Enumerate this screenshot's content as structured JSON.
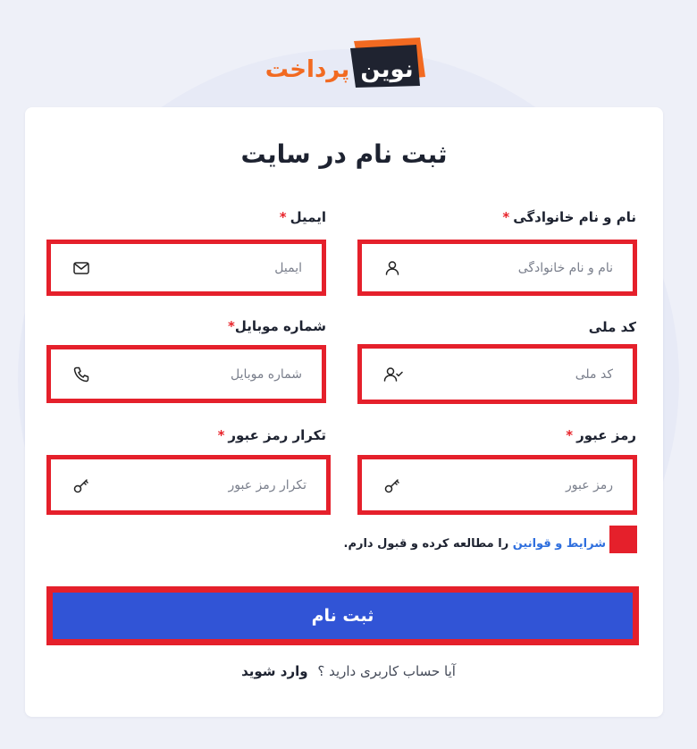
{
  "brand": {
    "logo_text": "نوین پرداخت",
    "accent": "#f26a21",
    "dark": "#1f2330"
  },
  "form": {
    "title": "ثبت نام در سایت",
    "required_mark": "*",
    "fields": {
      "full_name": {
        "label": "نام و نام خانوادگی",
        "placeholder": "نام و نام خانوادگی",
        "value": "",
        "required": true,
        "icon": "user-icon"
      },
      "email": {
        "label": "ایمیل",
        "placeholder": "ایمیل",
        "value": "",
        "required": true,
        "icon": "mail-icon"
      },
      "national_code": {
        "label": "کد ملی",
        "placeholder": "کد ملی",
        "value": "",
        "required": false,
        "icon": "user-check-icon"
      },
      "mobile": {
        "label": "شماره موبایل",
        "placeholder": "شماره موبایل",
        "value": "",
        "required": true,
        "icon": "phone-icon"
      },
      "password": {
        "label": "رمز عبور",
        "placeholder": "رمز عبور",
        "value": "",
        "required": true,
        "icon": "key-icon"
      },
      "password_confirm": {
        "label": "تکرار رمز عبور",
        "placeholder": "تکرار رمز عبور",
        "value": "",
        "required": true,
        "icon": "key-icon"
      }
    },
    "terms": {
      "link_text": "شرایط و قوانین",
      "suffix": " را مطالعه کرده و قبول دارم.",
      "checked": false
    },
    "submit_label": "ثبت نام",
    "login_prompt": "آیا حساب کاربری دارید ؟",
    "login_link": "وارد شوید"
  },
  "colors": {
    "highlight": "#e5202b",
    "primary": "#3154d6",
    "link": "#2f6fde"
  }
}
